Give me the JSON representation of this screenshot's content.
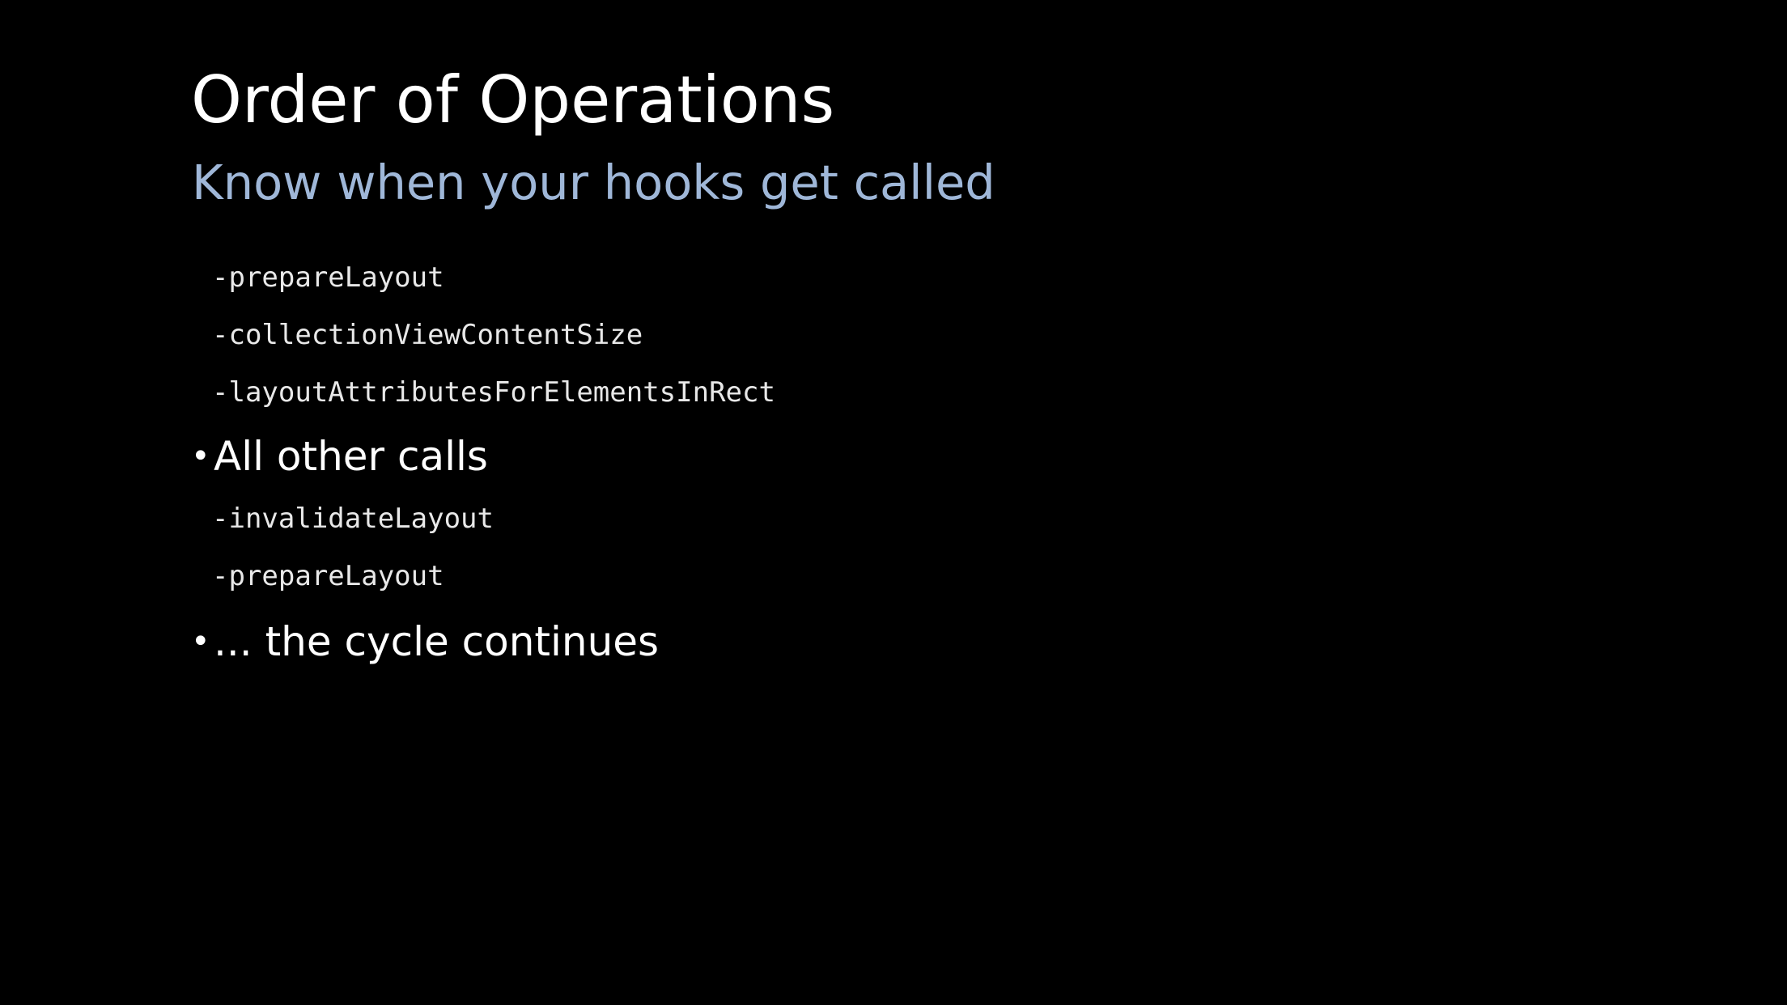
{
  "slide": {
    "title": "Order of Operations",
    "subtitle": "Know when your hooks get called",
    "items": [
      {
        "kind": "code",
        "text": "-prepareLayout"
      },
      {
        "kind": "code",
        "text": "-collectionViewContentSize"
      },
      {
        "kind": "code",
        "text": "-layoutAttributesForElementsInRect"
      },
      {
        "kind": "bullet",
        "text": "All other calls"
      },
      {
        "kind": "code",
        "text": "-invalidateLayout"
      },
      {
        "kind": "code",
        "text": "-prepareLayout"
      },
      {
        "kind": "bullet",
        "text": "... the cycle continues"
      }
    ],
    "bullet_glyph": "•"
  },
  "colors": {
    "background": "#000000",
    "title": "#ffffff",
    "subtitle": "#9fb7d8",
    "code": "#e8e8e8",
    "bullet_text": "#ffffff"
  }
}
